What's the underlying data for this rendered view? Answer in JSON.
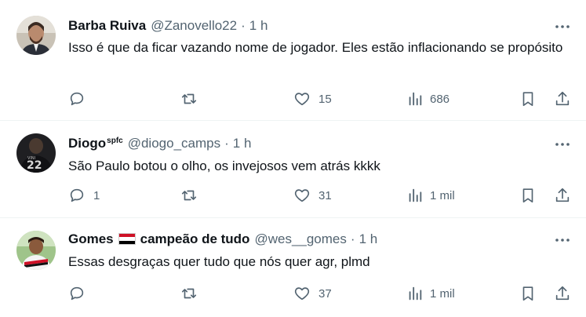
{
  "tweets": [
    {
      "name": "Barba Ruiva",
      "badge": "",
      "handle": "@Zanovello22",
      "dot": "·",
      "time": "1 h",
      "text": "Isso é que da ficar vazando nome de jogador. Eles estão inflacionando se propósito",
      "replies": "",
      "retweets": "",
      "likes": "15",
      "views": "686"
    },
    {
      "name": "Diogo",
      "badge": "spfc",
      "handle": "@diogo_camps",
      "dot": "·",
      "time": "1 h",
      "text": "São Paulo botou o olho, os invejosos vem atrás kkkk",
      "replies": "1",
      "retweets": "",
      "likes": "31",
      "views": "1 mil"
    },
    {
      "name": "Gomes",
      "name_suffix": "campeão de tudo",
      "badge": "",
      "handle": "@wes__gomes",
      "dot": "·",
      "time": "1 h",
      "text": "Essas desgraças quer tudo que nós quer agr, plmd",
      "replies": "",
      "retweets": "",
      "likes": "37",
      "views": "1 mil"
    }
  ],
  "icons": {
    "more": "more-dots-icon",
    "reply": "reply-icon",
    "retweet": "retweet-icon",
    "like": "heart-icon",
    "views": "views-icon",
    "bookmark": "bookmark-icon",
    "share": "share-icon"
  },
  "colors": {
    "text": "#0f1419",
    "secondary": "#536471",
    "divider": "#eff3f4"
  }
}
